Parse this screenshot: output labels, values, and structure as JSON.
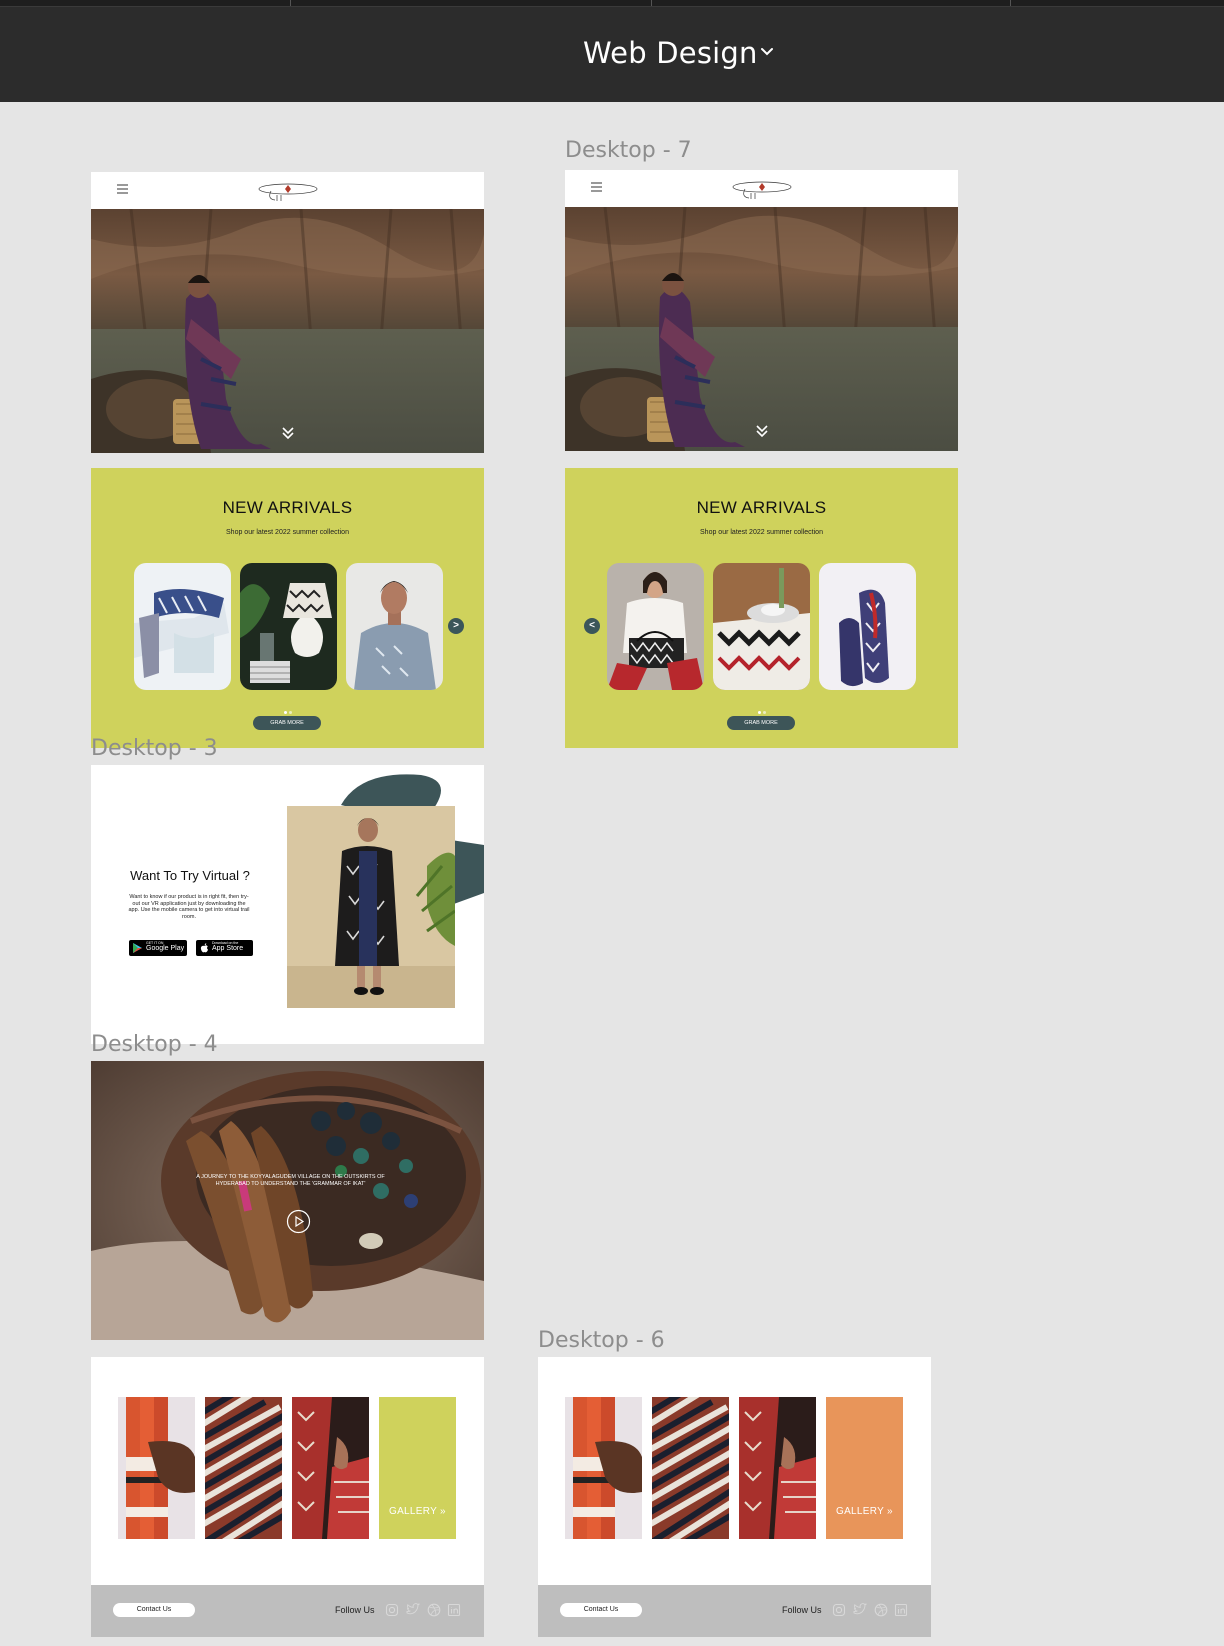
{
  "toolbar": {
    "project_title": "Web Design"
  },
  "frames": {
    "desktop7_label": "Desktop - 7",
    "desktop3_label": "Desktop - 3",
    "desktop4_label": "Desktop - 4",
    "desktop6_label": "Desktop - 6"
  },
  "arrivals": {
    "title": "NEW ARRIVALS",
    "subtitle": "Shop our latest 2022 summer collection",
    "grab_label": "GRAB MORE",
    "prev_glyph": "<",
    "next_glyph": ">"
  },
  "virtual": {
    "title": "Want To Try Virtual ?",
    "body": "Want to know if our product is in right fit, then try-out our VR application just by downloading the app. Use the mobile camera to get into virtual trail room.",
    "google_small": "GET IT ON",
    "google_label": "Google Play",
    "apple_small": "Download on the",
    "apple_label": "App Store"
  },
  "journey": {
    "text": "A JOURNEY TO THE KOYYALAGUDEM VILLAGE ON THE OUTSKIRTS OF HYDERABAD TO UNDERSTAND THE 'GRAMMAR OF IKAT'"
  },
  "gallery": {
    "label": "GALLERY",
    "chevron": "»"
  },
  "footer": {
    "contact_label": "Contact Us",
    "follow_label": "Follow Us"
  },
  "colors": {
    "toolbar_bg": "#2c2c2c",
    "canvas_bg": "#e5e5e5",
    "arrivals_bg": "#cfd25c",
    "accent_teal": "#3d5558",
    "gallery_green": "#cfd25c",
    "gallery_orange": "#e8955a",
    "footer_bg": "#bebebe"
  },
  "icons": [
    "chevron-down-icon",
    "hamburger-icon",
    "heart-icon",
    "search-icon",
    "cart-icon",
    "user-icon",
    "double-chevron-down-icon",
    "play-icon",
    "instagram-icon",
    "twitter-icon",
    "dribbble-icon",
    "linkedin-icon"
  ]
}
